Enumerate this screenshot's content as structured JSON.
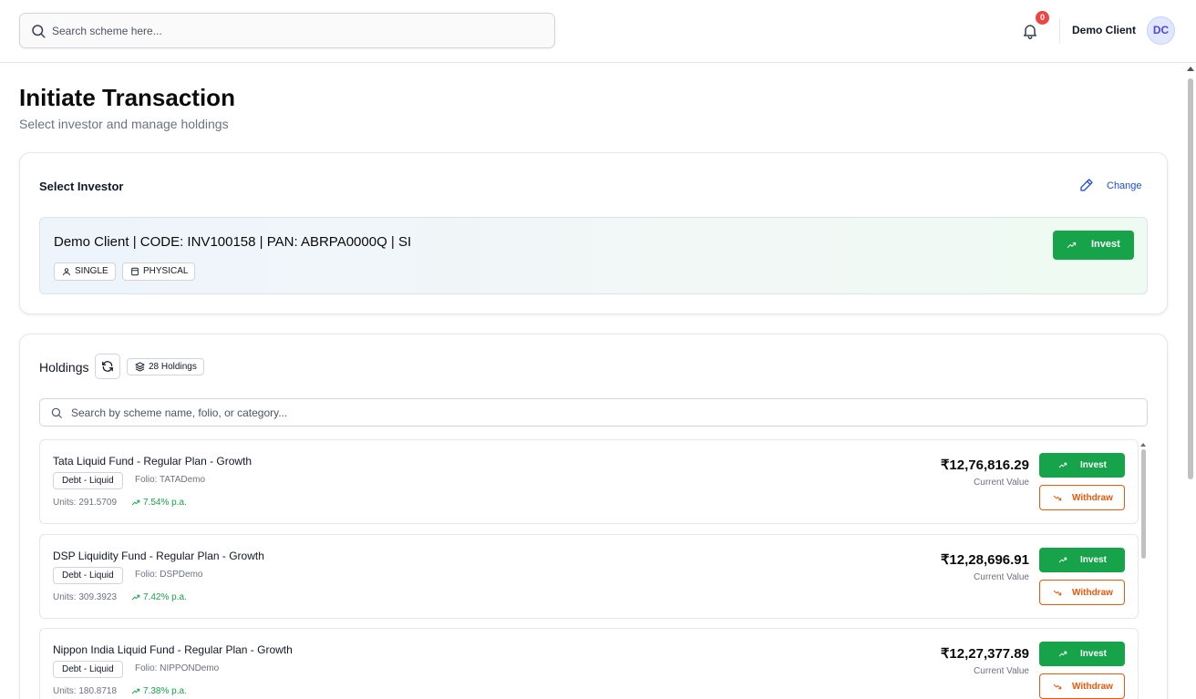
{
  "header": {
    "search_placeholder": "Search scheme here...",
    "notification_count": "0",
    "user_name": "Demo Client",
    "avatar_initials": "DC"
  },
  "page": {
    "title": "Initiate Transaction",
    "subtitle": "Select investor and manage holdings"
  },
  "investor_section": {
    "heading": "Select Investor",
    "change_label": "Change",
    "investor_line": "Demo Client | CODE: INV100158 | PAN: ABRPA0000Q | SI",
    "tags": [
      "SINGLE",
      "PHYSICAL"
    ],
    "invest_label": "Invest"
  },
  "holdings_section": {
    "heading": "Holdings",
    "count_label": "28 Holdings",
    "search_placeholder": "Search by scheme name, folio, or category...",
    "invest_label": "Invest",
    "withdraw_label": "Withdraw",
    "value_label": "Current Value",
    "items": [
      {
        "name": "Tata Liquid Fund - Regular Plan - Growth",
        "category": "Debt - Liquid",
        "folio": "Folio: TATADemo",
        "units": "Units: 291.5709",
        "returns": "7.54% p.a.",
        "value": "₹12,76,816.29"
      },
      {
        "name": "DSP Liquidity Fund - Regular Plan - Growth",
        "category": "Debt - Liquid",
        "folio": "Folio: DSPDemo",
        "units": "Units: 309.3923",
        "returns": "7.42% p.a.",
        "value": "₹12,28,696.91"
      },
      {
        "name": "Nippon India Liquid Fund - Regular Plan - Growth",
        "category": "Debt - Liquid",
        "folio": "Folio: NIPPONDemo",
        "units": "Units: 180.8718",
        "returns": "7.38% p.a.",
        "value": "₹12,27,377.89"
      }
    ]
  },
  "colors": {
    "invest_green": "#16a34a",
    "withdraw_orange": "#ea580c",
    "link_blue": "#1d4ed8",
    "badge_red": "#ef4444"
  },
  "icons": [
    "search-icon",
    "bell-icon",
    "pencil-icon",
    "user-icon",
    "file-icon",
    "trending-up-icon",
    "trending-down-icon",
    "refresh-icon",
    "layers-icon"
  ]
}
